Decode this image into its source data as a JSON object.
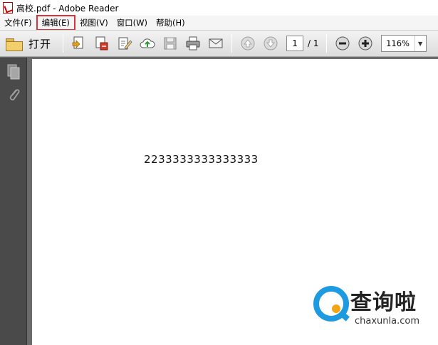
{
  "window": {
    "title": "高校.pdf - Adobe Reader"
  },
  "menubar": {
    "items": [
      {
        "label": "文件(F)"
      },
      {
        "label": "编辑(E)"
      },
      {
        "label": "视图(V)"
      },
      {
        "label": "窗口(W)"
      },
      {
        "label": "帮助(H)"
      }
    ],
    "highlighted": "编辑(E)"
  },
  "toolbar": {
    "open_label": "打开",
    "icons": [
      "create-pdf-icon",
      "convert-pdf-icon",
      "sign-icon",
      "upload-cloud-icon",
      "save-icon",
      "print-icon",
      "email-icon",
      "previous-page-icon",
      "next-page-icon",
      "zoom-out-icon",
      "zoom-in-icon"
    ],
    "page": {
      "current": "1",
      "total": "/ 1"
    },
    "zoom": {
      "value": "116%"
    }
  },
  "leftpanel": {
    "icons": [
      "pages-icon",
      "attachments-icon"
    ]
  },
  "document": {
    "text": "2233333333333333"
  },
  "watermark": {
    "brand": "查询啦",
    "url": "chaxunla.com",
    "colors": {
      "ring": "#1e9be0",
      "dot": "#f2a516"
    }
  },
  "colors": {
    "highlight_box": "#d9343b",
    "panel_background": "#4a4a4a",
    "workspace_background": "#6b6b6b"
  }
}
